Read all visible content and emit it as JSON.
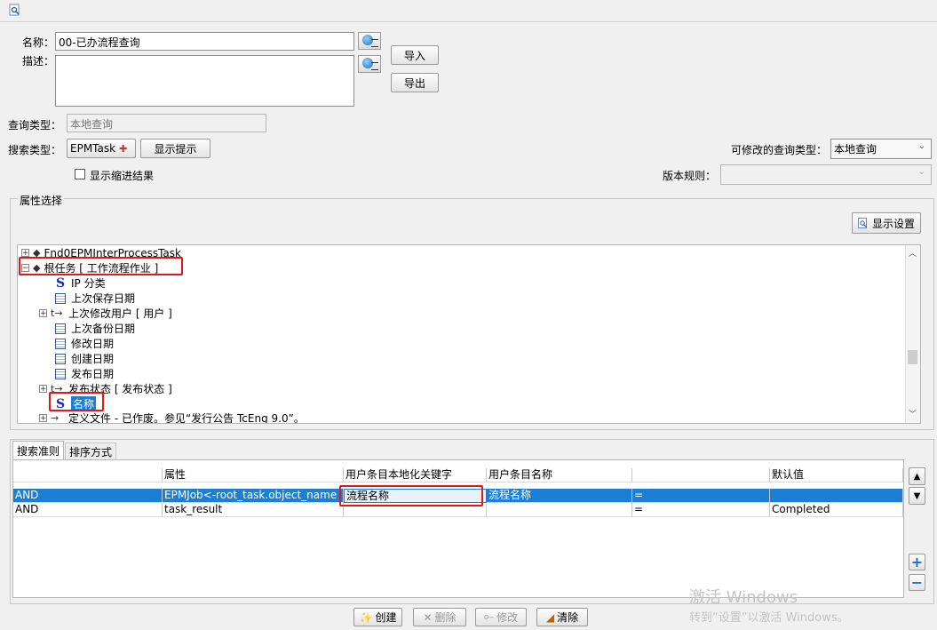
{
  "form": {
    "name_label": "名称：",
    "name_value": "00-已办流程查询",
    "desc_label": "描述：",
    "desc_value": "",
    "import_label": "导入",
    "export_label": "导出",
    "query_type_label": "查询类型：",
    "query_type_value": "本地查询",
    "search_type_label": "搜索类型：",
    "search_type_value": "EPMTask",
    "show_hint_label": "显示提示",
    "modifiable_type_label": "可修改的查询类型：",
    "modifiable_type_value": "本地查询",
    "indent_checkbox_label": "显示缩进结果",
    "version_rule_label": "版本规则："
  },
  "attr_section": {
    "title": "属性选择",
    "display_settings_label": "显示设置",
    "tree": [
      {
        "text": "Fnd0EPMInterProcessTask"
      },
      {
        "text": "根任务 [ 工作流程作业 ]"
      },
      {
        "text": "IP 分类"
      },
      {
        "text": "上次保存日期"
      },
      {
        "text": "上次修改用户 [ 用户 ]"
      },
      {
        "text": "上次备份日期"
      },
      {
        "text": "修改日期"
      },
      {
        "text": "创建日期"
      },
      {
        "text": "发布日期"
      },
      {
        "text": "发布状态 [ 发布状态 ]"
      },
      {
        "text": "名称"
      },
      {
        "text": "定义文件 - 已作废。参见“发行公告 TcEng 9.0”。"
      }
    ]
  },
  "criteria": {
    "tabs": [
      "搜索准则",
      "排序方式"
    ],
    "columns": [
      "",
      "属性",
      "用户条目本地化关键字",
      "用户条目名称",
      "",
      "默认值"
    ],
    "rows": [
      [
        "AND",
        "EPMJob<-root_task.object_name",
        "流程名称",
        "流程名称",
        "=",
        ""
      ],
      [
        "AND",
        "task_result",
        "",
        "",
        "=",
        "Completed"
      ]
    ]
  },
  "bottom_buttons": {
    "create": "创建",
    "delete": "删除",
    "modify": "修改",
    "clear": "清除"
  },
  "watermark": {
    "line1": "激活 Windows",
    "line2": "转到“设置”以激活 Windows。"
  },
  "colors": {
    "selection": "#1c7fd6",
    "highlight_box": "#e01818"
  }
}
